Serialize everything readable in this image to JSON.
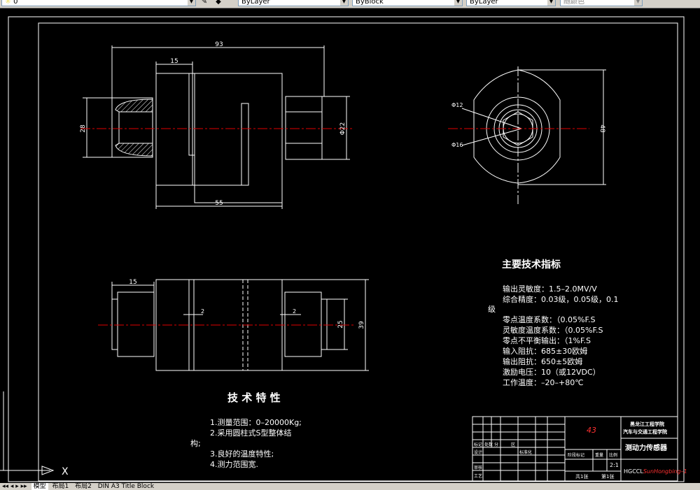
{
  "toolbar": {
    "layer_value": "0",
    "color_value": "ByLayer",
    "linetype_value": "ByBlock",
    "lineweight_value": "ByLayer",
    "plotstyle_value": "随颜色"
  },
  "drawing": {
    "front_view": {
      "dim_overall": "93",
      "dim_top_step": "15",
      "dim_left_height": "28",
      "dim_right_dia": "Φ22",
      "dim_bottom": "55"
    },
    "side_view": {
      "dim_outer_dia": "Φ12",
      "dim_inner_dia": "Φ16",
      "dim_height": "48"
    },
    "bottom_view": {
      "dim_step": "15",
      "dim_slot_left": "2",
      "dim_slot_right": "2",
      "dim_inner": "25",
      "dim_outer": "39"
    },
    "specs": {
      "title": "主要技术指标",
      "lines": [
        "输出灵敏度：1.5–2.0MV/V",
        "综合精度：0.03级，0.05级，0.1",
        "零点温度系数：（0.05%F.S",
        "灵敏度温度系数：（0.05%F.S",
        "零点不平衡输出：（1%F.S",
        "输入阻抗：685±30欧姆",
        "输出阻抗：650±5欧姆",
        "激励电压：10（或12VDC）",
        "工作温度：–20–+80℃"
      ],
      "wrap": "级"
    },
    "features": {
      "title": "技 术 特 性",
      "lines": [
        "1.测量范围：0–20000Kg;",
        "2.采用圆柱式S型整体结",
        "3.良好的温度特性;",
        "4.测力范围宽."
      ],
      "wrap": "构;"
    },
    "title_block": {
      "number": "43",
      "school": "黑龙江工程学院",
      "dept": "汽车与交通工程学院",
      "name": "测动力传感器",
      "code_prefix": "HGCCL",
      "code_suffix": "SunHongbing–1",
      "marker_label": "标记",
      "count_label": "处数",
      "zone_label": "分",
      "doc_label": "区",
      "design_label": "设计",
      "std_label": "标准化",
      "review_label": "审核",
      "craft_label": "工艺",
      "stage_label": "阶段标记",
      "weight_label": "重量",
      "ratio_label": "比例",
      "scale_value": "2:1",
      "sheets_label": "共1张",
      "sheet_label": "第1张"
    },
    "ucs": {
      "x_label": "X"
    }
  },
  "tabs": {
    "items": [
      "模型",
      "布局1",
      "布局2",
      "DIN A3 Title Block"
    ]
  },
  "colors": {
    "background": "#000000",
    "lines": "#ffffff",
    "centerline": "#e00000",
    "hatch": "#ffffff",
    "accent": "#ff3030"
  }
}
